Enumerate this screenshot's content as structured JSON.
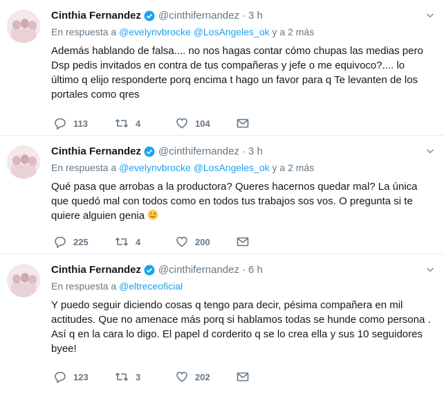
{
  "tweets": [
    {
      "name": "Cinthia Fernandez",
      "handle": "@cinthifernandez",
      "time": "3 h",
      "reply_prefix": "En respuesta a",
      "reply_to_1": "@evelynvbrocke",
      "reply_to_2": "@LosAngeles_ok",
      "reply_suffix": "y a 2 más",
      "text": "Además hablando de falsa.... no nos hagas contar cómo chupas las medias pero Dsp pedis invitados en contra de tus compañeras y jefe o me equivoco?.... lo último q elijo responderte porq encima t hago un favor para q Te levanten de los portales como qres",
      "replies": "113",
      "retweets": "4",
      "likes": "104"
    },
    {
      "name": "Cinthia Fernandez",
      "handle": "@cinthifernandez",
      "time": "3 h",
      "reply_prefix": "En respuesta a",
      "reply_to_1": "@evelynvbrocke",
      "reply_to_2": "@LosAngeles_ok",
      "reply_suffix": "y a 2 más",
      "text": "Qué pasa que arrobas a la productora? Queres hacernos quedar mal? La única que quedó mal con todos como en todos tus trabajos sos vos. O pregunta si te quiere alguien genia",
      "replies": "225",
      "retweets": "4",
      "likes": "200"
    },
    {
      "name": "Cinthia Fernandez",
      "handle": "@cinthifernandez",
      "time": "6 h",
      "reply_prefix": "En respuesta a",
      "reply_to_1": "@eltreceoficial",
      "text": "Y puedo seguir diciendo cosas q tengo para decir, pésima compañera en mil actitudes. Que no amenace más porq si hablamos todas se hunde como persona . Así q en la cara lo digo. El papel d corderito q se lo crea ella y sus 10 seguidores byee!",
      "replies": "123",
      "retweets": "3",
      "likes": "202"
    }
  ],
  "colors": {
    "link": "#1da1f2",
    "muted": "#657786",
    "text": "#14171a",
    "verified": "#1da1f2"
  }
}
